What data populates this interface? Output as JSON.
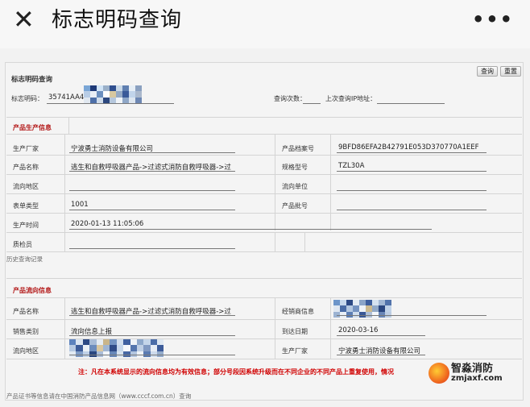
{
  "header": {
    "title": "标志明码查询"
  },
  "panel": {
    "title": "标志明码查询",
    "buttons": {
      "query": "查询",
      "reset": "重置"
    },
    "query_row": {
      "code_label": "标志明码：",
      "code_value": "35741AA4",
      "count_label": "查询次数：",
      "ip_label": "上次查询IP地址："
    },
    "production": {
      "section_title": "产品生产信息",
      "manufacturer_label": "生产厂家",
      "manufacturer_value": "宁波勇士消防设备有限公司",
      "archive_label": "产品档案号",
      "archive_value": "9BFD86EFA2B42791E053D370770A1EEF",
      "name_label": "产品名称",
      "name_value": "逃生和自救呼吸器产品->过滤式消防自救呼吸器->过",
      "model_label": "规格型号",
      "model_value": "TZL30A",
      "region_label": "流向地区",
      "unit_label": "流向单位",
      "form_label": "表单类型",
      "form_value": "1001",
      "batch_label": "产品批号",
      "time_label": "生产时间",
      "time_value": "2020-01-13 11:05:06",
      "inspector_label": "质检员"
    },
    "history_label": "历史查询记录",
    "flow": {
      "section_title": "产品流向信息",
      "name_label": "产品名称",
      "name_value": "逃生和自救呼吸器产品->过滤式消防自救呼吸器->过",
      "dealer_label": "经销商信息",
      "sales_label": "销售类别",
      "sales_value": "流向信息上报",
      "arrive_label": "到达日期",
      "arrive_value": "2020-03-16",
      "region_label": "流向地区",
      "manufacturer_label": "生产厂家",
      "manufacturer_value": "宁波勇士消防设备有限公司"
    },
    "notice": "注：凡在本系统显示的流向信息均为有效信息；部分号段因系统升级而在不同企业的不同产品上重复使用，情况",
    "footer": "产品证书等信息请在中国消防产品信息网（www.cccf.com.cn）查询"
  },
  "watermark": {
    "name": "智淼消防",
    "url": "zmjaxf.com"
  },
  "colors": {
    "section_title": "#b11212",
    "notice": "#d00000",
    "background": "#f2f2f2"
  }
}
